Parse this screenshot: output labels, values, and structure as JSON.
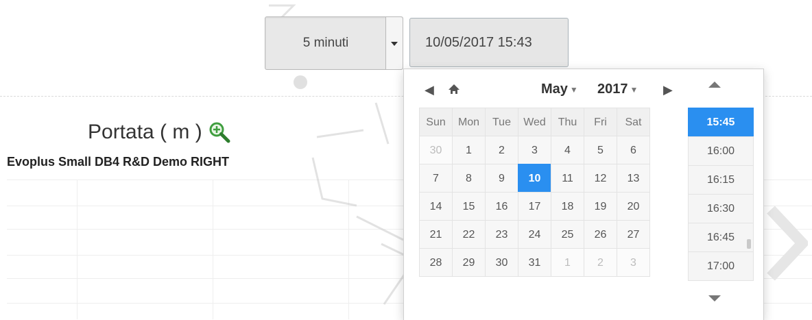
{
  "interval": {
    "selected": "5 minuti"
  },
  "datetime": {
    "value": "10/05/2017 15:43"
  },
  "chart": {
    "title": "Portata ( m )",
    "subtitle": "Evoplus Small DB4 R&D Demo RIGHT"
  },
  "picker": {
    "month": "May",
    "year": "2017",
    "weekdays": [
      "Sun",
      "Mon",
      "Tue",
      "Wed",
      "Thu",
      "Fri",
      "Sat"
    ],
    "days": [
      {
        "d": "30",
        "muted": true
      },
      {
        "d": "1"
      },
      {
        "d": "2"
      },
      {
        "d": "3"
      },
      {
        "d": "4"
      },
      {
        "d": "5"
      },
      {
        "d": "6"
      },
      {
        "d": "7"
      },
      {
        "d": "8"
      },
      {
        "d": "9"
      },
      {
        "d": "10",
        "selected": true
      },
      {
        "d": "11"
      },
      {
        "d": "12"
      },
      {
        "d": "13"
      },
      {
        "d": "14"
      },
      {
        "d": "15"
      },
      {
        "d": "16"
      },
      {
        "d": "17"
      },
      {
        "d": "18"
      },
      {
        "d": "19"
      },
      {
        "d": "20"
      },
      {
        "d": "21"
      },
      {
        "d": "22"
      },
      {
        "d": "23"
      },
      {
        "d": "24"
      },
      {
        "d": "25"
      },
      {
        "d": "26"
      },
      {
        "d": "27"
      },
      {
        "d": "28"
      },
      {
        "d": "29"
      },
      {
        "d": "30"
      },
      {
        "d": "31"
      },
      {
        "d": "1",
        "muted": true
      },
      {
        "d": "2",
        "muted": true
      },
      {
        "d": "3",
        "muted": true
      }
    ],
    "times": [
      {
        "t": "15:45",
        "selected": true
      },
      {
        "t": "16:00"
      },
      {
        "t": "16:15"
      },
      {
        "t": "16:30"
      },
      {
        "t": "16:45"
      },
      {
        "t": "17:00"
      }
    ],
    "icons": {
      "prev": "chevron-left-icon",
      "home": "home-icon",
      "next": "chevron-right-icon",
      "time_up": "caret-up-icon",
      "time_down": "caret-down-icon"
    }
  },
  "colors": {
    "accent": "#2a8ff0",
    "zoom_icon": "#3f9e3f"
  }
}
